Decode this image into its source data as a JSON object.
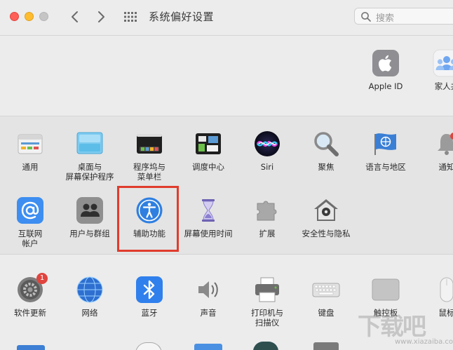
{
  "window": {
    "title": "系统偏好设置",
    "search_placeholder": "搜索"
  },
  "account": [
    {
      "id": "apple-id",
      "label": "Apple ID"
    },
    {
      "id": "family",
      "label": "家人共"
    }
  ],
  "prefs_row1": [
    {
      "id": "general",
      "label": "通用"
    },
    {
      "id": "desktop",
      "label": "桌面与\n屏幕保护程序"
    },
    {
      "id": "dock",
      "label": "程序坞与\n菜单栏"
    },
    {
      "id": "mission-control",
      "label": "调度中心"
    },
    {
      "id": "siri",
      "label": "Siri"
    },
    {
      "id": "spotlight",
      "label": "聚焦"
    },
    {
      "id": "language",
      "label": "语言与地区"
    },
    {
      "id": "notifications",
      "label": "通知"
    }
  ],
  "prefs_row2": [
    {
      "id": "internet-accounts",
      "label": "互联网\n帐户"
    },
    {
      "id": "users-groups",
      "label": "用户与群组"
    },
    {
      "id": "accessibility",
      "label": "辅助功能"
    },
    {
      "id": "screen-time",
      "label": "屏幕使用时间"
    },
    {
      "id": "extensions",
      "label": "扩展"
    },
    {
      "id": "security",
      "label": "安全性与隐私"
    }
  ],
  "prefs_row3": [
    {
      "id": "software-update",
      "label": "软件更新",
      "badge": "1"
    },
    {
      "id": "network",
      "label": "网络"
    },
    {
      "id": "bluetooth",
      "label": "蓝牙"
    },
    {
      "id": "sound",
      "label": "声音"
    },
    {
      "id": "printers",
      "label": "打印机与\n扫描仪"
    },
    {
      "id": "keyboard",
      "label": "键盘"
    },
    {
      "id": "trackpad",
      "label": "触控板"
    },
    {
      "id": "mouse",
      "label": "鼠标"
    }
  ],
  "colors": {
    "highlight": "#e03c2d"
  },
  "watermark": {
    "text": "下载吧",
    "url": "www.xiazaiba.com"
  }
}
